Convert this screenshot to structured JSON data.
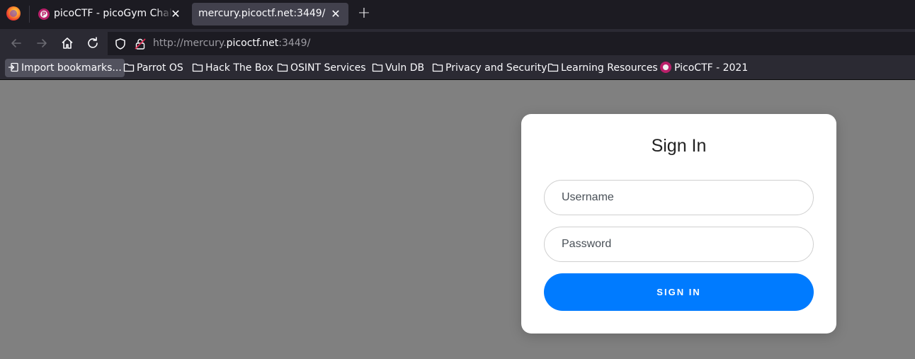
{
  "browser": {
    "tabs": [
      {
        "title": "picoCTF - picoGym Challenges",
        "active": false
      },
      {
        "title": "mercury.picoctf.net:3449/",
        "active": true
      }
    ],
    "new_tab_symbol": "+",
    "close_symbol": "✕",
    "url": {
      "prefix": "http://mercury.",
      "host": "picoctf.net",
      "suffix": ":3449/"
    },
    "bookmarks": [
      {
        "label": "Import bookmarks...",
        "icon": "import-icon"
      },
      {
        "label": "Parrot OS",
        "icon": "folder-icon"
      },
      {
        "label": "Hack The Box",
        "icon": "folder-icon"
      },
      {
        "label": "OSINT Services",
        "icon": "folder-icon"
      },
      {
        "label": "Vuln DB",
        "icon": "folder-icon"
      },
      {
        "label": "Privacy and Security",
        "icon": "folder-icon"
      },
      {
        "label": "Learning Resources",
        "icon": "folder-icon"
      },
      {
        "label": "PicoCTF - 2021",
        "icon": "picoctf-favicon"
      }
    ]
  },
  "login": {
    "title": "Sign In",
    "username_placeholder": "Username",
    "password_placeholder": "Password",
    "submit_label": "SIGN IN"
  },
  "colors": {
    "page_background": "#808080",
    "button_primary": "#007bff",
    "card_background": "#ffffff",
    "browser_chrome": "#1c1b22"
  }
}
